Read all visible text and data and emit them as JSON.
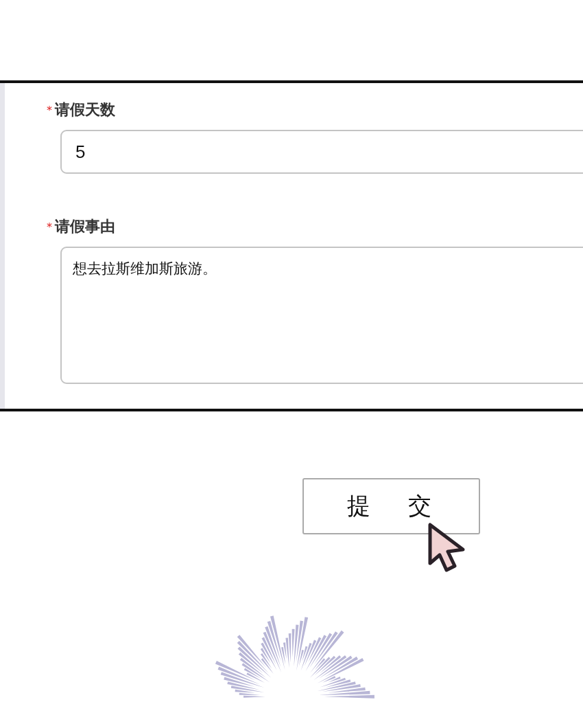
{
  "form": {
    "fields": [
      {
        "kind": "input",
        "label": "请假天数",
        "required_mark": "*",
        "value": "5"
      },
      {
        "kind": "textarea",
        "label": "请假事由",
        "required_mark": "*",
        "value": "想去拉斯维加斯旅游。"
      }
    ]
  },
  "submit_button": {
    "label": "提交"
  }
}
